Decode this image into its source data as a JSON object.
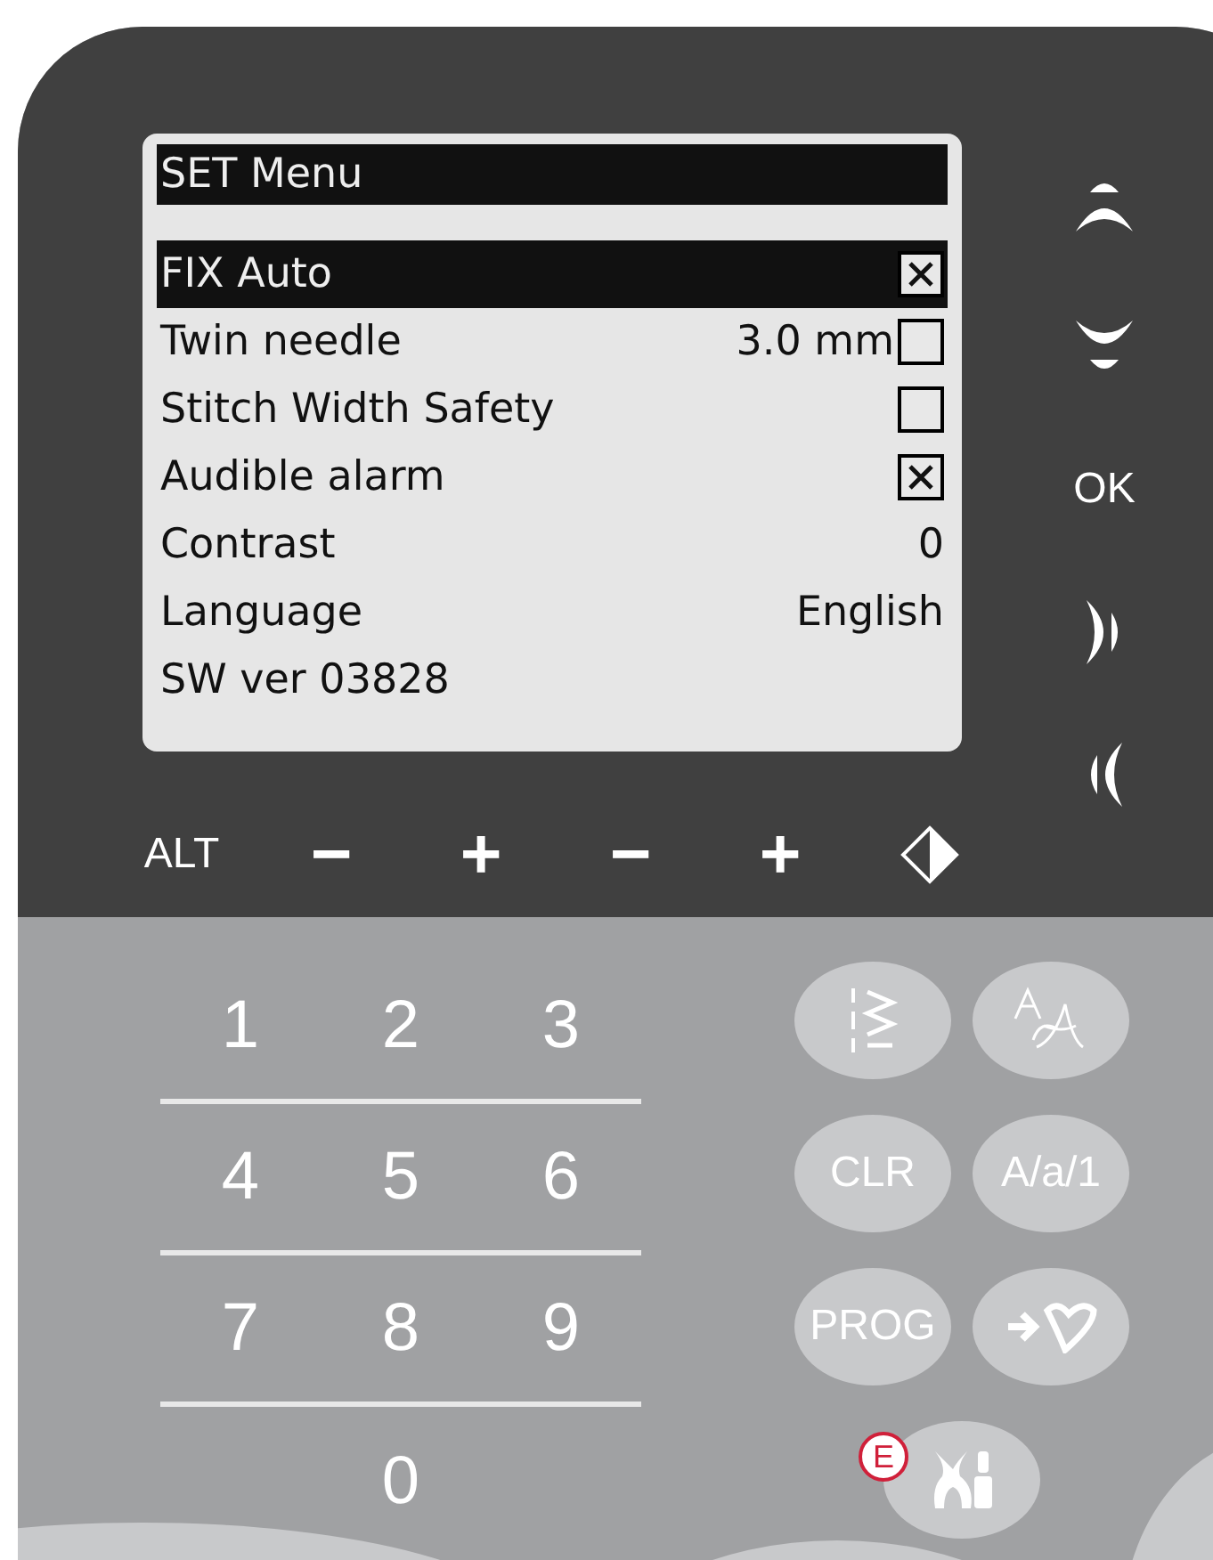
{
  "screen": {
    "title": "SET Menu",
    "items": [
      {
        "kind": "checkbox",
        "label": "FIX Auto",
        "selected": true,
        "checked": true
      },
      {
        "kind": "checkbox",
        "label": "Twin needle",
        "value": "3.0 mm",
        "selected": false,
        "checked": false
      },
      {
        "kind": "checkbox",
        "label": "Stitch Width Safety",
        "selected": false,
        "checked": false
      },
      {
        "kind": "checkbox",
        "label": "Audible alarm",
        "selected": false,
        "checked": true
      },
      {
        "kind": "value",
        "label": "Contrast",
        "value": "0",
        "selected": false
      },
      {
        "kind": "value",
        "label": "Language",
        "value": "English",
        "selected": false
      },
      {
        "kind": "info",
        "label": "SW ver 03828",
        "selected": false
      }
    ]
  },
  "side_buttons": [
    {
      "kind": "up"
    },
    {
      "kind": "down"
    },
    {
      "kind": "text",
      "label": "OK"
    },
    {
      "kind": "right"
    },
    {
      "kind": "left"
    }
  ],
  "bottom_buttons": [
    {
      "kind": "text",
      "label": "ALT"
    },
    {
      "kind": "minus",
      "label": "−"
    },
    {
      "kind": "plus",
      "label": "+"
    },
    {
      "kind": "minus",
      "label": "−"
    },
    {
      "kind": "plus",
      "label": "+"
    },
    {
      "kind": "mirror"
    }
  ],
  "keypad": [
    [
      "1",
      "2",
      "3"
    ],
    [
      "4",
      "5",
      "6"
    ],
    [
      "7",
      "8",
      "9"
    ],
    [
      "0"
    ]
  ],
  "function_buttons": [
    {
      "kind": "stitch"
    },
    {
      "kind": "font"
    },
    {
      "kind": "text",
      "label": "CLR"
    },
    {
      "kind": "text",
      "label": "A/a/1"
    },
    {
      "kind": "text",
      "label": "PROG"
    },
    {
      "kind": "favorite"
    },
    {
      "kind": "settings",
      "badge": "E"
    }
  ]
}
